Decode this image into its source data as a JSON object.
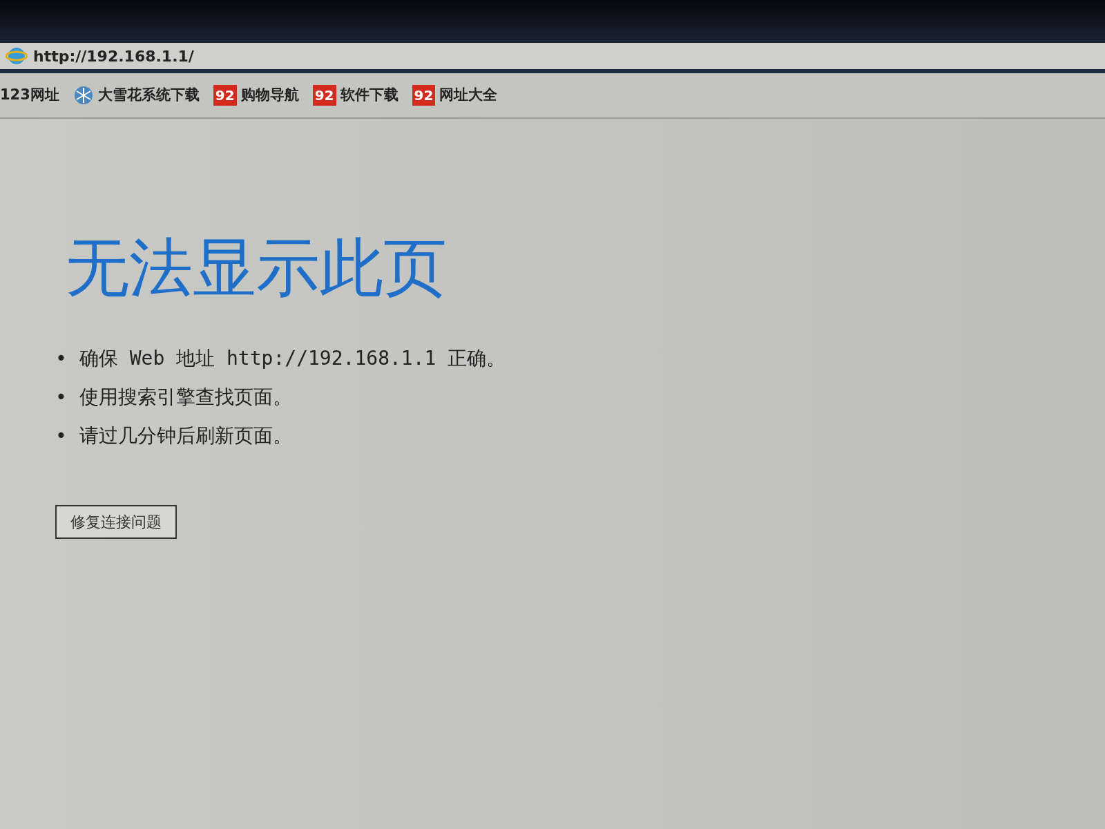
{
  "address_bar": {
    "url": "http://192.168.1.1/"
  },
  "favorites": [
    {
      "label": "123网址",
      "kind": "plain"
    },
    {
      "label": "大雪花系统下载",
      "kind": "snowflake"
    },
    {
      "label": "购物导航",
      "kind": "badge",
      "badge": "92"
    },
    {
      "label": "软件下载",
      "kind": "badge",
      "badge": "92"
    },
    {
      "label": "网址大全",
      "kind": "badge",
      "badge": "92"
    }
  ],
  "page": {
    "title": "无法显示此页",
    "tips": [
      {
        "bullet": "•",
        "text": "确保 Web 地址 http://192.168.1.1 正确。"
      },
      {
        "bullet": "•",
        "text": "使用搜索引擎查找页面。"
      },
      {
        "bullet": "•",
        "text": "请过几分钟后刷新页面。"
      }
    ],
    "button": "修复连接问题"
  }
}
